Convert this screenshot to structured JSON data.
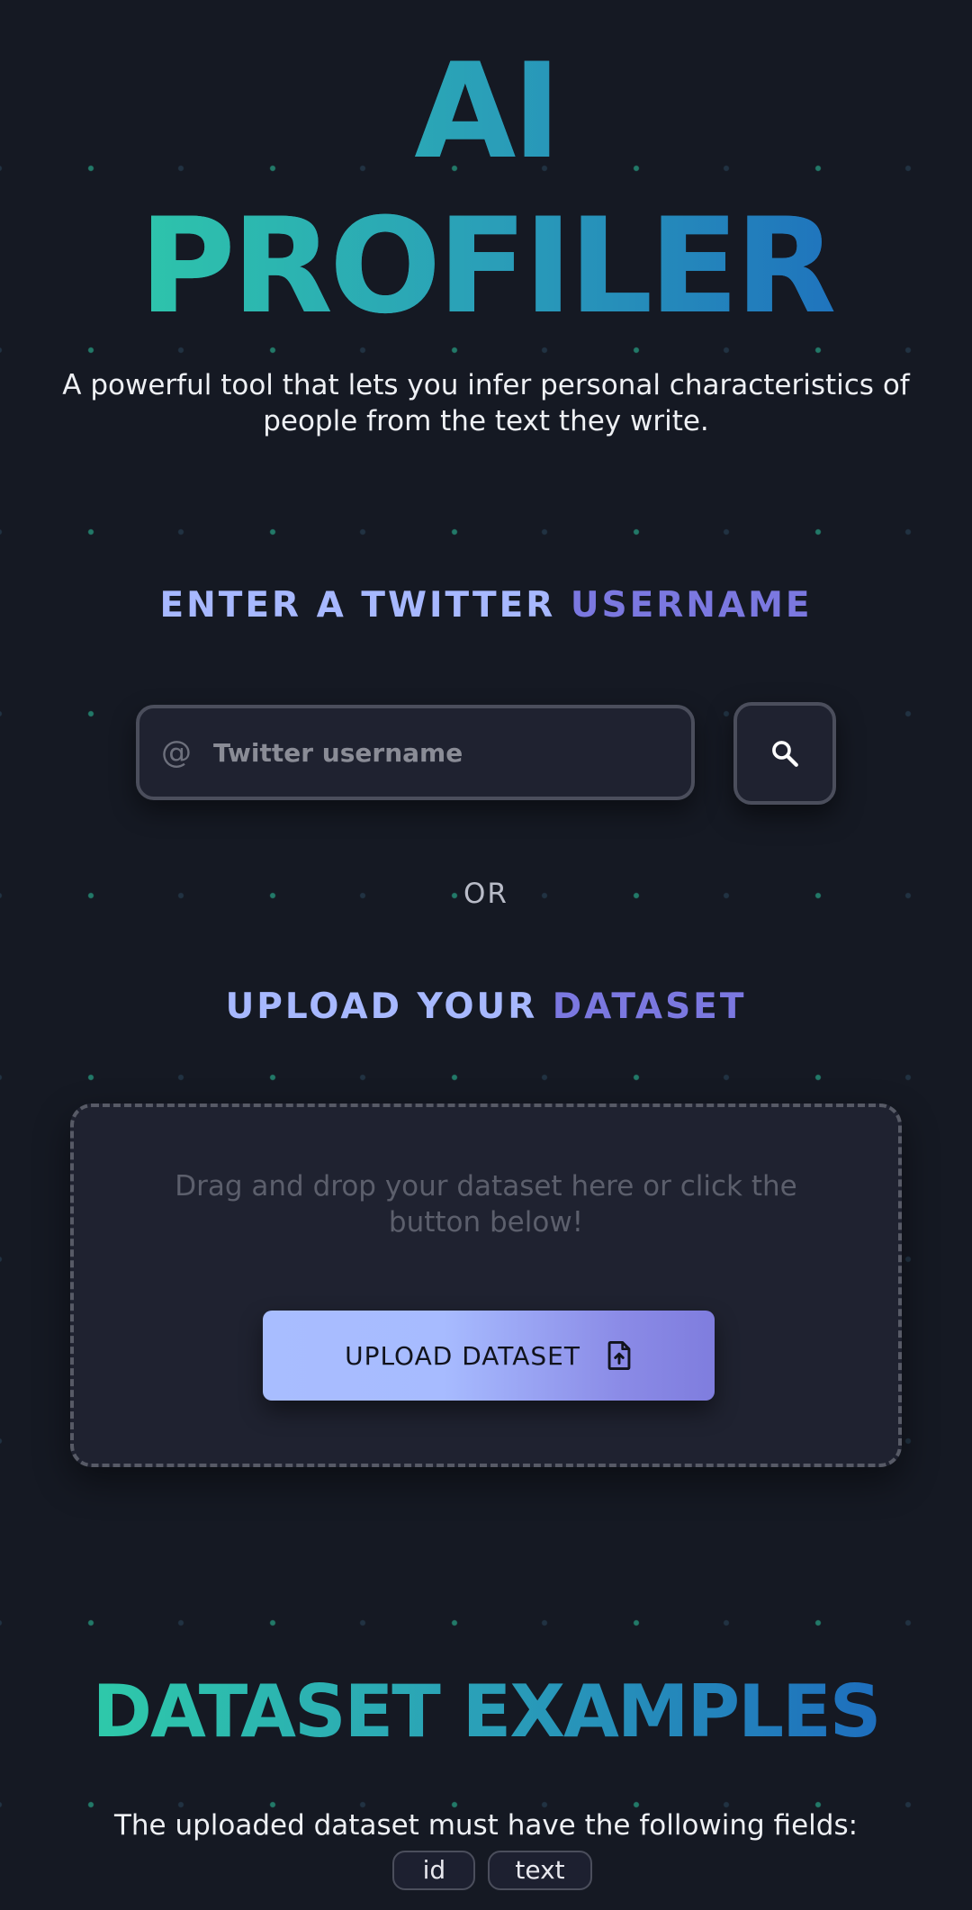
{
  "hero": {
    "title_line1": "AI",
    "title_line2": "PROFILER",
    "subtitle": "A powerful tool that lets you infer personal characteristics of people from the text they write."
  },
  "twitter_section": {
    "heading_part1": "ENTER A TWITTER ",
    "heading_part2": "USERNAME",
    "at_symbol": "@",
    "input_placeholder": "Twitter username",
    "input_value": "",
    "search_icon": "search-icon"
  },
  "divider": {
    "or_label": "OR"
  },
  "upload_section": {
    "heading_part1": "UPLOAD YOUR ",
    "heading_part2": "DATASET",
    "dropzone_text": "Drag and drop your dataset here or click the button below!",
    "button_label": "UPLOAD DATASET",
    "button_icon": "file-upload-icon"
  },
  "examples_section": {
    "heading": "DATASET EXAMPLES",
    "description": "The uploaded dataset must have the following fields:",
    "fields": [
      "id",
      "text"
    ]
  },
  "colors": {
    "background": "#151923",
    "gradient_start": "#2fd3a6",
    "gradient_end": "#1b63bf",
    "heading_light": "#a7b8ff",
    "heading_accent": "#7b78e0",
    "panel": "#1f2230"
  }
}
